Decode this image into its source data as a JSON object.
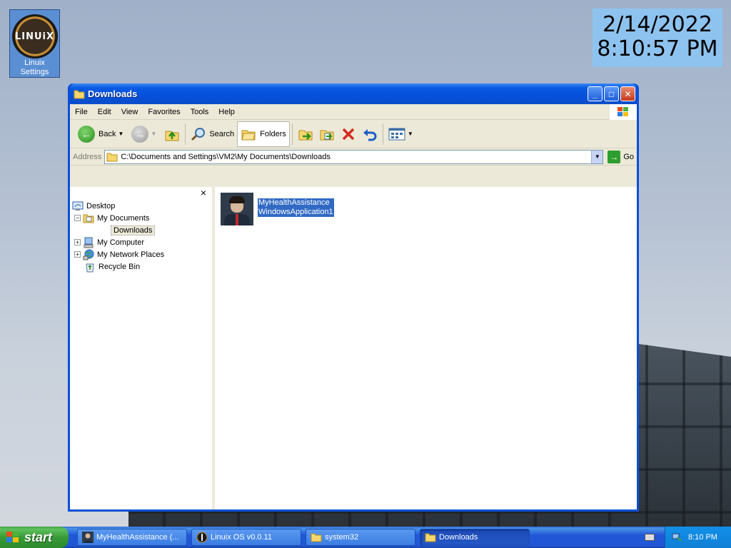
{
  "desktop": {
    "icon": {
      "logo_text": "LINUiX",
      "label": "Linuix Settings"
    },
    "clock": {
      "date": "2/14/2022",
      "time": "8:10:57 PM"
    }
  },
  "window": {
    "title": "Downloads",
    "menu": [
      "File",
      "Edit",
      "View",
      "Favorites",
      "Tools",
      "Help"
    ],
    "toolbar": {
      "back": "Back",
      "search": "Search",
      "folders": "Folders"
    },
    "address": {
      "label": "Address",
      "value": "C:\\Documents and Settings\\VM2\\My Documents\\Downloads",
      "go": "Go"
    },
    "tree": {
      "close": "×",
      "items": [
        "Desktop",
        "My Documents",
        "Downloads",
        "My Computer",
        "My Network Places",
        "Recycle Bin"
      ]
    },
    "files": [
      {
        "name_line1": "MyHealthAssistance",
        "name_line2": "WindowsApplication1"
      }
    ]
  },
  "taskbar": {
    "start": "start",
    "tasks": [
      "MyHealthAssistance (...",
      "Linuix OS v0.0.11",
      "system32",
      "Downloads"
    ],
    "time": "8:10 PM"
  }
}
